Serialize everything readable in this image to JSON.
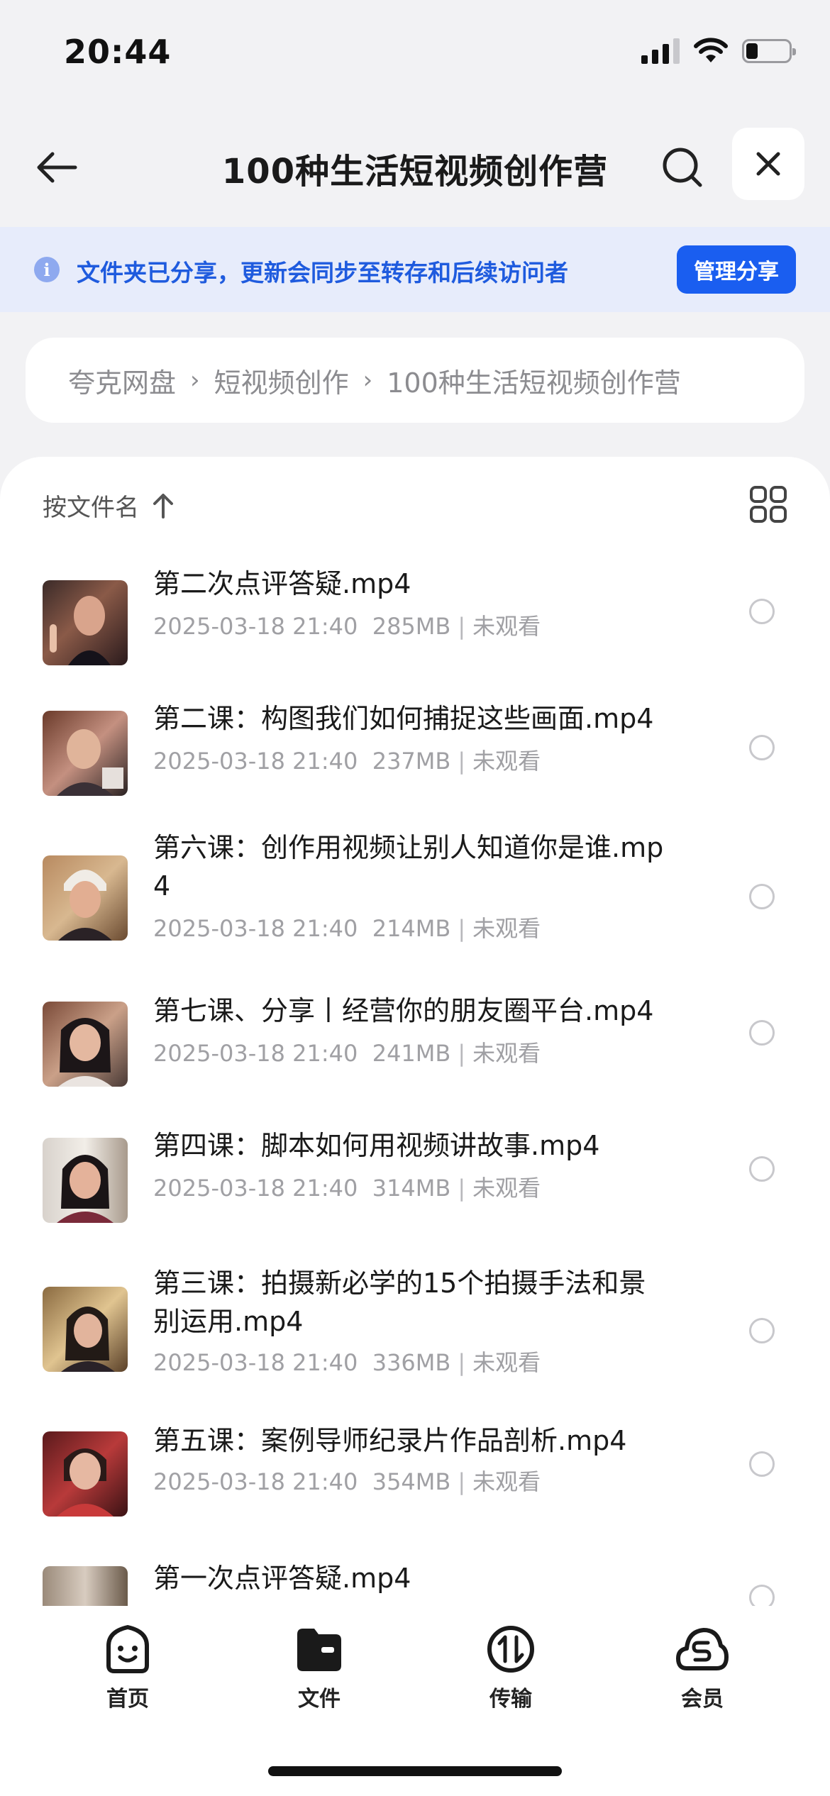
{
  "status_bar": {
    "time": "20:44"
  },
  "header": {
    "title": "100种生活短视频创作营"
  },
  "notice": {
    "text": "文件夹已分享，更新会同步至转存和后续访问者",
    "button": "管理分享"
  },
  "breadcrumb": [
    "夸克网盘",
    "短视频创作",
    "100种生活短视频创作营"
  ],
  "list": {
    "sort_label": "按文件名",
    "files": [
      {
        "name": "第二次点评答疑.mp4",
        "date": "2025-03-18 21:40",
        "size": "285MB",
        "status": "未观看"
      },
      {
        "name": "第二课：构图我们如何捕捉这些画面.mp4",
        "date": "2025-03-18 21:40",
        "size": "237MB",
        "status": "未观看"
      },
      {
        "name": "第六课：创作用视频让别人知道你是谁.mp4",
        "date": "2025-03-18 21:40",
        "size": "214MB",
        "status": "未观看"
      },
      {
        "name": "第七课、分享丨经营你的朋友圈平台.mp4",
        "date": "2025-03-18 21:40",
        "size": "241MB",
        "status": "未观看"
      },
      {
        "name": "第四课：脚本如何用视频讲故事.mp4",
        "date": "2025-03-18 21:40",
        "size": "314MB",
        "status": "未观看"
      },
      {
        "name": "第三课：拍摄新必学的15个拍摄手法和景别运用.mp4",
        "date": "2025-03-18 21:40",
        "size": "336MB",
        "status": "未观看"
      },
      {
        "name": "第五课：案例导师纪录片作品剖析.mp4",
        "date": "2025-03-18 21:40",
        "size": "354MB",
        "status": "未观看"
      },
      {
        "name": "第一次点评答疑.mp4",
        "date": "",
        "size": "",
        "status": ""
      }
    ]
  },
  "tabbar": [
    {
      "label": "首页",
      "icon": "home-face-icon"
    },
    {
      "label": "文件",
      "icon": "folder-icon"
    },
    {
      "label": "传输",
      "icon": "transfer-icon"
    },
    {
      "label": "会员",
      "icon": "vip-cloud-icon"
    }
  ],
  "colors": {
    "accent": "#1a5ef0",
    "notice_bg": "#e7ecfb",
    "notice_text": "#1f5bde"
  }
}
